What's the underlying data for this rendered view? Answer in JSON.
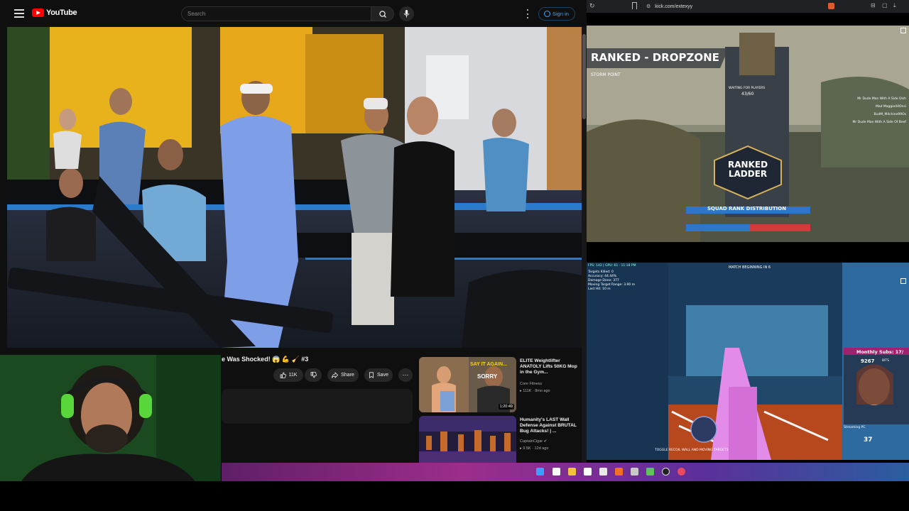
{
  "youtube": {
    "logo_text": "YouTube",
    "search_placeholder": "Search",
    "signin_label": "Sign in",
    "video_title": "e Was Shocked! 😱 💪 🧹 #3",
    "actions": {
      "likes": "11K",
      "share": "Share",
      "save": "Save"
    },
    "recommendations": [
      {
        "title": "ELITE Weightlifter ANATOLY Lifts 50KG Mop in the Gym... ",
        "channel": "Core Fitness",
        "meta": "▸ 111K · 8mo ago",
        "duration": "1:20:49",
        "thumb_text": "SAY IT AGAIN... SORRY"
      },
      {
        "title": "Humanity's LAST Wall Defense Against BRUTAL Bug Attacks! | ...",
        "channel": "CaptainCigar ✔",
        "meta": "▸ 9.5K · 12d ago",
        "duration": ""
      }
    ]
  },
  "kick": {
    "url": "kick.com/extexyy",
    "stream1": {
      "mode_title": "RANKED - DROPZONE",
      "location": "STORM POINT",
      "waiting": "WAITING FOR PLAYERS",
      "count": "43/60",
      "ladder_line1": "RANKED",
      "ladder_line2": "LADDER",
      "distribution": "SQUAD RANK DISTRIBUTION",
      "feed": [
        "Mr Dude Man With A Side Dish",
        "Mad Maggie44Onsi",
        "BudM_M4chine99Os",
        "Mr Dude Man With A Side Of Beef"
      ]
    },
    "stream2": {
      "match_text": "MATCH BEGINNING IN 6",
      "fps_line": "FPS: 142 | GPU: 61 · 11:18 PM",
      "stats": [
        "Targets Killed: 0",
        "Accuracy: 44.44%",
        "Damage Done: 377",
        "Moving Target Range: 3.90 m",
        "Last Hit: 10 m"
      ],
      "sub_banner": "Monthly Subs: 17/",
      "sub_count": "9267",
      "bits": "BITS",
      "streamer_label": "Streaming PC",
      "ammo": "37",
      "toggle_text": "TOGGLE RECOIL WALL AND MOVING TARGETS"
    }
  }
}
